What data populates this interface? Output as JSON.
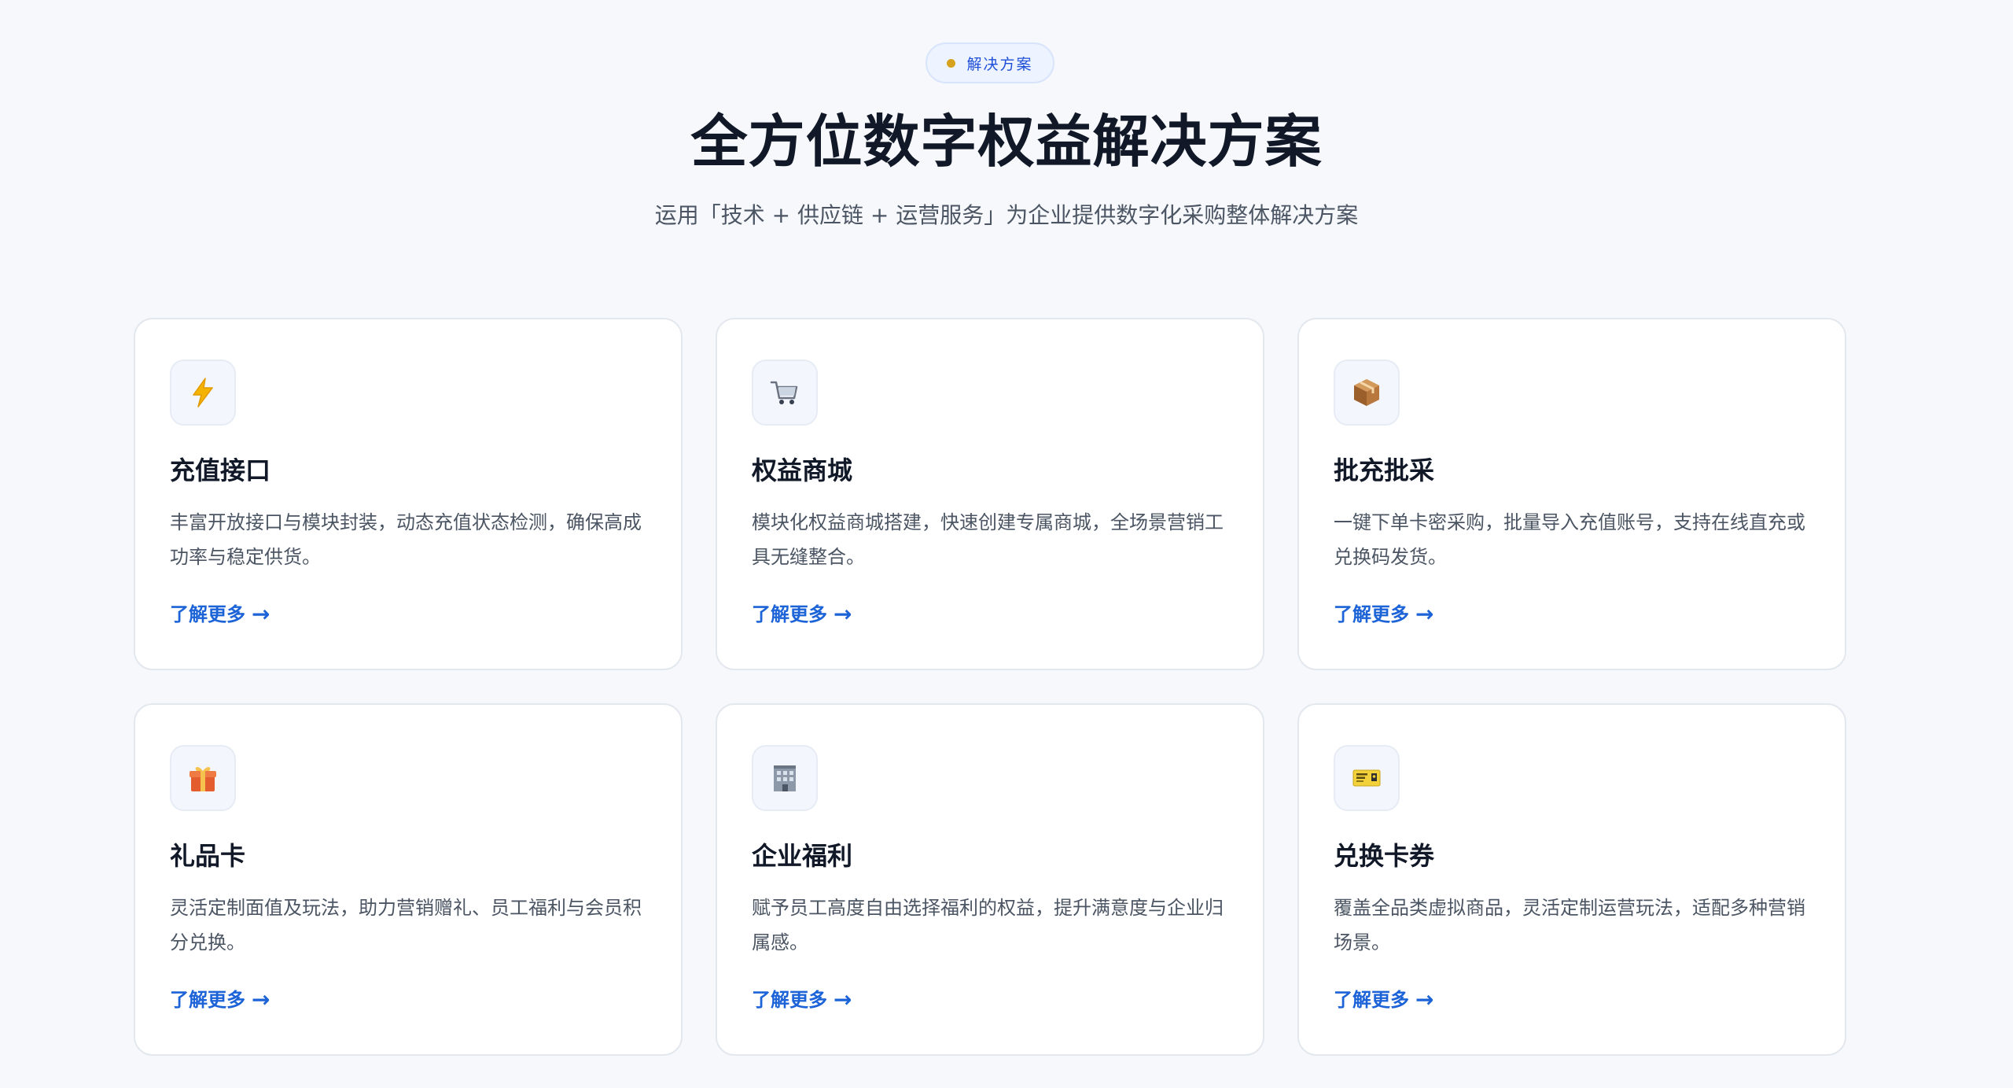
{
  "badge": {
    "label": "解决方案",
    "dot_color": "#d6a21e"
  },
  "header": {
    "title": "全方位数字权益解决方案",
    "subtitle": "运用「技术 + 供应链 + 运营服务」为企业提供数字化采购整体解决方案"
  },
  "cards": [
    {
      "icon": "lightning-icon",
      "title": "充值接口",
      "description": "丰富开放接口与模块封装，动态充值状态检测，确保高成功率与稳定供货。",
      "link_label": "了解更多",
      "link_arrow": "→"
    },
    {
      "icon": "shopping-cart-icon",
      "title": "权益商城",
      "description": "模块化权益商城搭建，快速创建专属商城，全场景营销工具无缝整合。",
      "link_label": "了解更多",
      "link_arrow": "→"
    },
    {
      "icon": "package-icon",
      "title": "批充批采",
      "description": "一键下单卡密采购，批量导入充值账号，支持在线直充或兑换码发货。",
      "link_label": "了解更多",
      "link_arrow": "→"
    },
    {
      "icon": "gift-icon",
      "title": "礼品卡",
      "description": "灵活定制面值及玩法，助力营销赠礼、员工福利与会员积分兑换。",
      "link_label": "了解更多",
      "link_arrow": "→"
    },
    {
      "icon": "office-building-icon",
      "title": "企业福利",
      "description": "赋予员工高度自由选择福利的权益，提升满意度与企业归属感。",
      "link_label": "了解更多",
      "link_arrow": "→"
    },
    {
      "icon": "ticket-icon",
      "title": "兑换卡券",
      "description": "覆盖全品类虚拟商品，灵活定制运营玩法，适配多种营销场景。",
      "link_label": "了解更多",
      "link_arrow": "→"
    }
  ],
  "colors": {
    "page_background": "#f6f8fb",
    "accent_blue": "#1d63d8",
    "title_text": "#111827",
    "body_text": "#4b5563"
  }
}
